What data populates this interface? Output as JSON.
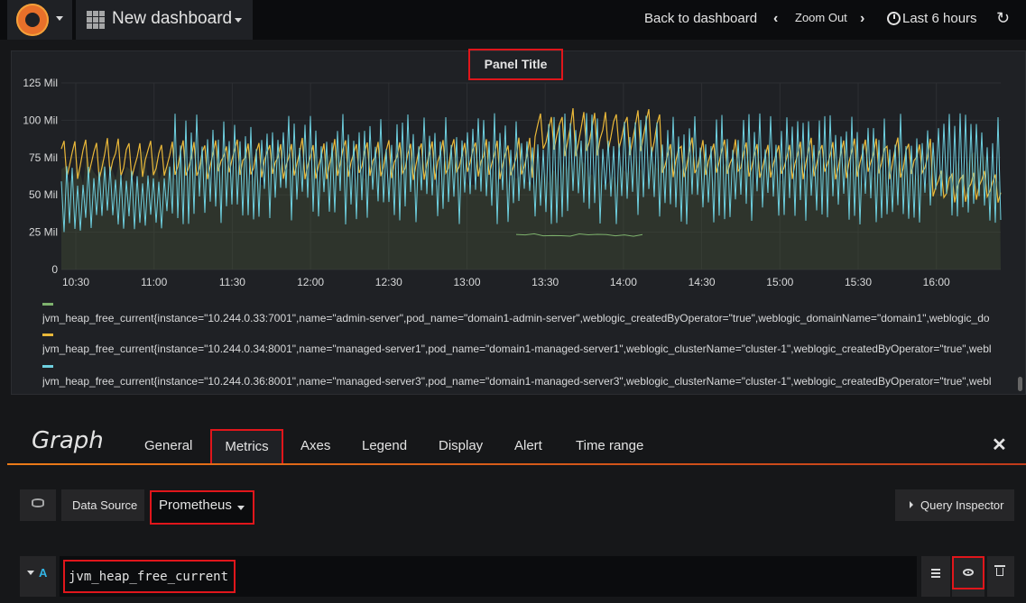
{
  "navbar": {
    "dashboard_title": "New dashboard",
    "back_label": "Back to dashboard",
    "zoom_out_label": "Zoom Out",
    "time_range_label": "Last 6 hours"
  },
  "panel": {
    "title": "Panel Title"
  },
  "chart_data": {
    "type": "line",
    "y_ticks": [
      "125 Mil",
      "100 Mil",
      "75 Mil",
      "50 Mil",
      "25 Mil",
      "0"
    ],
    "x_ticks": [
      "10:30",
      "11:00",
      "11:30",
      "12:00",
      "12:30",
      "13:00",
      "13:30",
      "14:00",
      "14:30",
      "15:00",
      "15:30",
      "16:00"
    ],
    "ylim": [
      0,
      125000000
    ],
    "series": [
      {
        "name": "jvm_heap_free_current{instance=\"10.244.0.33:7001\",name=\"admin-server\",pod_name=\"domain1-admin-server\",weblogic_createdByOperator=\"true\",weblogic_domainName=\"domain1\",weblogic_do",
        "color": "#7eb26d"
      },
      {
        "name": "jvm_heap_free_current{instance=\"10.244.0.34:8001\",name=\"managed-server1\",pod_name=\"domain1-managed-server1\",weblogic_clusterName=\"cluster-1\",weblogic_createdByOperator=\"true\",webl",
        "color": "#eab839"
      },
      {
        "name": "jvm_heap_free_current{instance=\"10.244.0.36:8001\",name=\"managed-server3\",pod_name=\"domain1-managed-server3\",weblogic_clusterName=\"cluster-1\",weblogic_createdByOperator=\"true\",webl",
        "color": "#6ed0e0"
      }
    ],
    "grid": true,
    "legend_placement": "bottom"
  },
  "editor": {
    "title": "Graph",
    "tabs": [
      "General",
      "Metrics",
      "Axes",
      "Legend",
      "Display",
      "Alert",
      "Time range"
    ],
    "active_tab": "Metrics",
    "data_source_label": "Data Source",
    "data_source_value": "Prometheus",
    "query_inspector_label": "Query Inspector",
    "query": {
      "ref_id": "A",
      "expr": "jvm_heap_free_current"
    }
  }
}
